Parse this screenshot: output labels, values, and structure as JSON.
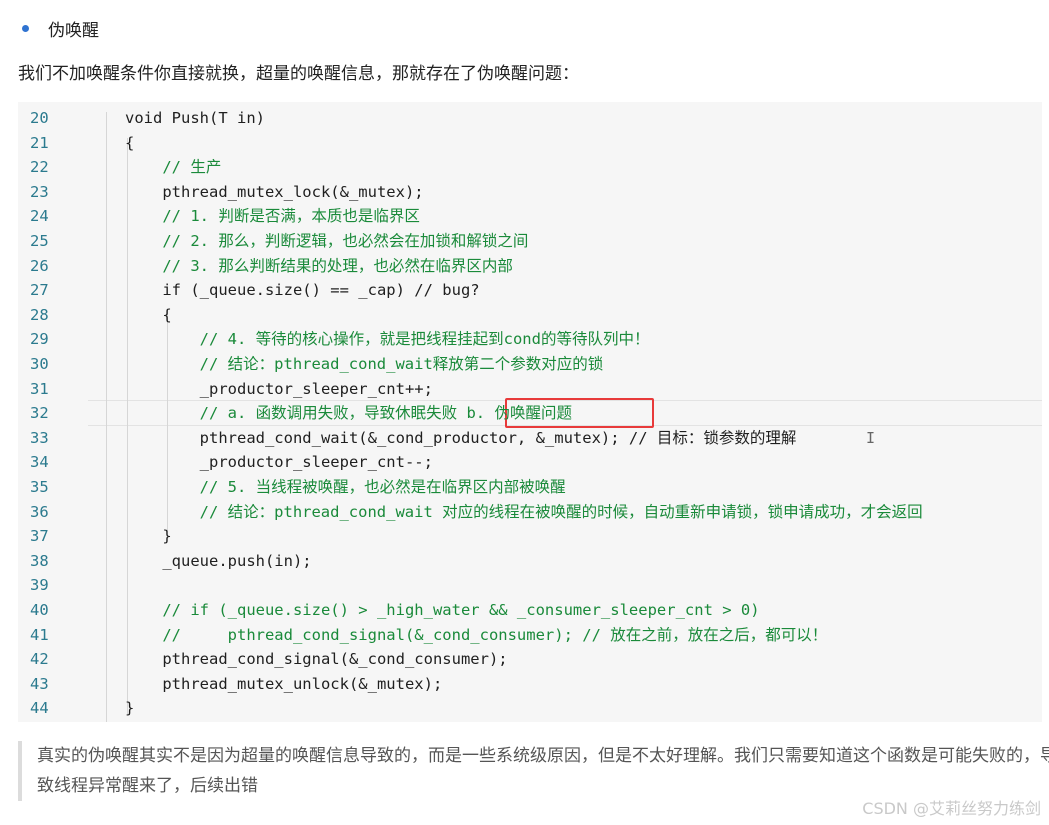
{
  "bullet": "伪唤醒",
  "intro": "我们不加唤醒条件你直接就换，超量的唤醒信息，那就存在了伪唤醒问题：",
  "code_lines": [
    {
      "n": "20",
      "text": "void Push(T in)",
      "comment": false
    },
    {
      "n": "21",
      "text": "{",
      "comment": false
    },
    {
      "n": "22",
      "text": "    // 生产",
      "comment": true
    },
    {
      "n": "23",
      "text": "    pthread_mutex_lock(&_mutex);",
      "comment": false
    },
    {
      "n": "24",
      "text": "    // 1. 判断是否满，本质也是临界区",
      "comment": true
    },
    {
      "n": "25",
      "text": "    // 2. 那么，判断逻辑，也必然会在加锁和解锁之间",
      "comment": true
    },
    {
      "n": "26",
      "text": "    // 3. 那么判断结果的处理，也必然在临界区内部",
      "comment": true
    },
    {
      "n": "27",
      "text": "    if (_queue.size() == _cap) // bug?",
      "comment": false
    },
    {
      "n": "28",
      "text": "    {",
      "comment": false
    },
    {
      "n": "29",
      "text": "        // 4. 等待的核心操作，就是把线程挂起到cond的等待队列中！",
      "comment": true
    },
    {
      "n": "30",
      "text": "        // 结论：pthread_cond_wait释放第二个参数对应的锁",
      "comment": true
    },
    {
      "n": "31",
      "text": "        _productor_sleeper_cnt++;",
      "comment": false
    },
    {
      "n": "32",
      "text": "        // a. 函数调用失败，导致休眠失败 b. 伪唤醒问题",
      "comment": true
    },
    {
      "n": "33",
      "text": "        pthread_cond_wait(&_cond_productor, &_mutex); // 目标：锁参数的理解",
      "comment": false
    },
    {
      "n": "34",
      "text": "        _productor_sleeper_cnt--;",
      "comment": false
    },
    {
      "n": "35",
      "text": "        // 5. 当线程被唤醒，也必然是在临界区内部被唤醒",
      "comment": true
    },
    {
      "n": "36",
      "text": "        // 结论：pthread_cond_wait 对应的线程在被唤醒的时候，自动重新申请锁，锁申请成功，才会返回",
      "comment": true
    },
    {
      "n": "37",
      "text": "    }",
      "comment": false
    },
    {
      "n": "38",
      "text": "    _queue.push(in);",
      "comment": false
    },
    {
      "n": "39",
      "text": "",
      "comment": false
    },
    {
      "n": "40",
      "text": "    // if (_queue.size() > _high_water && _consumer_sleeper_cnt > 0)",
      "comment": true
    },
    {
      "n": "41",
      "text": "    //     pthread_cond_signal(&_cond_consumer); // 放在之前，放在之后，都可以！",
      "comment": true
    },
    {
      "n": "42",
      "text": "    pthread_cond_signal(&_cond_consumer);",
      "comment": false
    },
    {
      "n": "43",
      "text": "    pthread_mutex_unlock(&_mutex);",
      "comment": false
    },
    {
      "n": "44",
      "text": "}",
      "comment": false
    }
  ],
  "quote": "真实的伪唤醒其实不是因为超量的唤醒信息导致的，而是一些系统级原因，但是不太好理解。我们只需要知道这个函数是可能失败的，导致线程异常醒来了，后续出错",
  "watermark": "CSDN @艾莉丝努力练剑",
  "colors": {
    "accent": "#2f73d1",
    "highlight_box": "#e83a3a",
    "comment": "#1a8a3a",
    "line_number": "#2b7a8e"
  }
}
